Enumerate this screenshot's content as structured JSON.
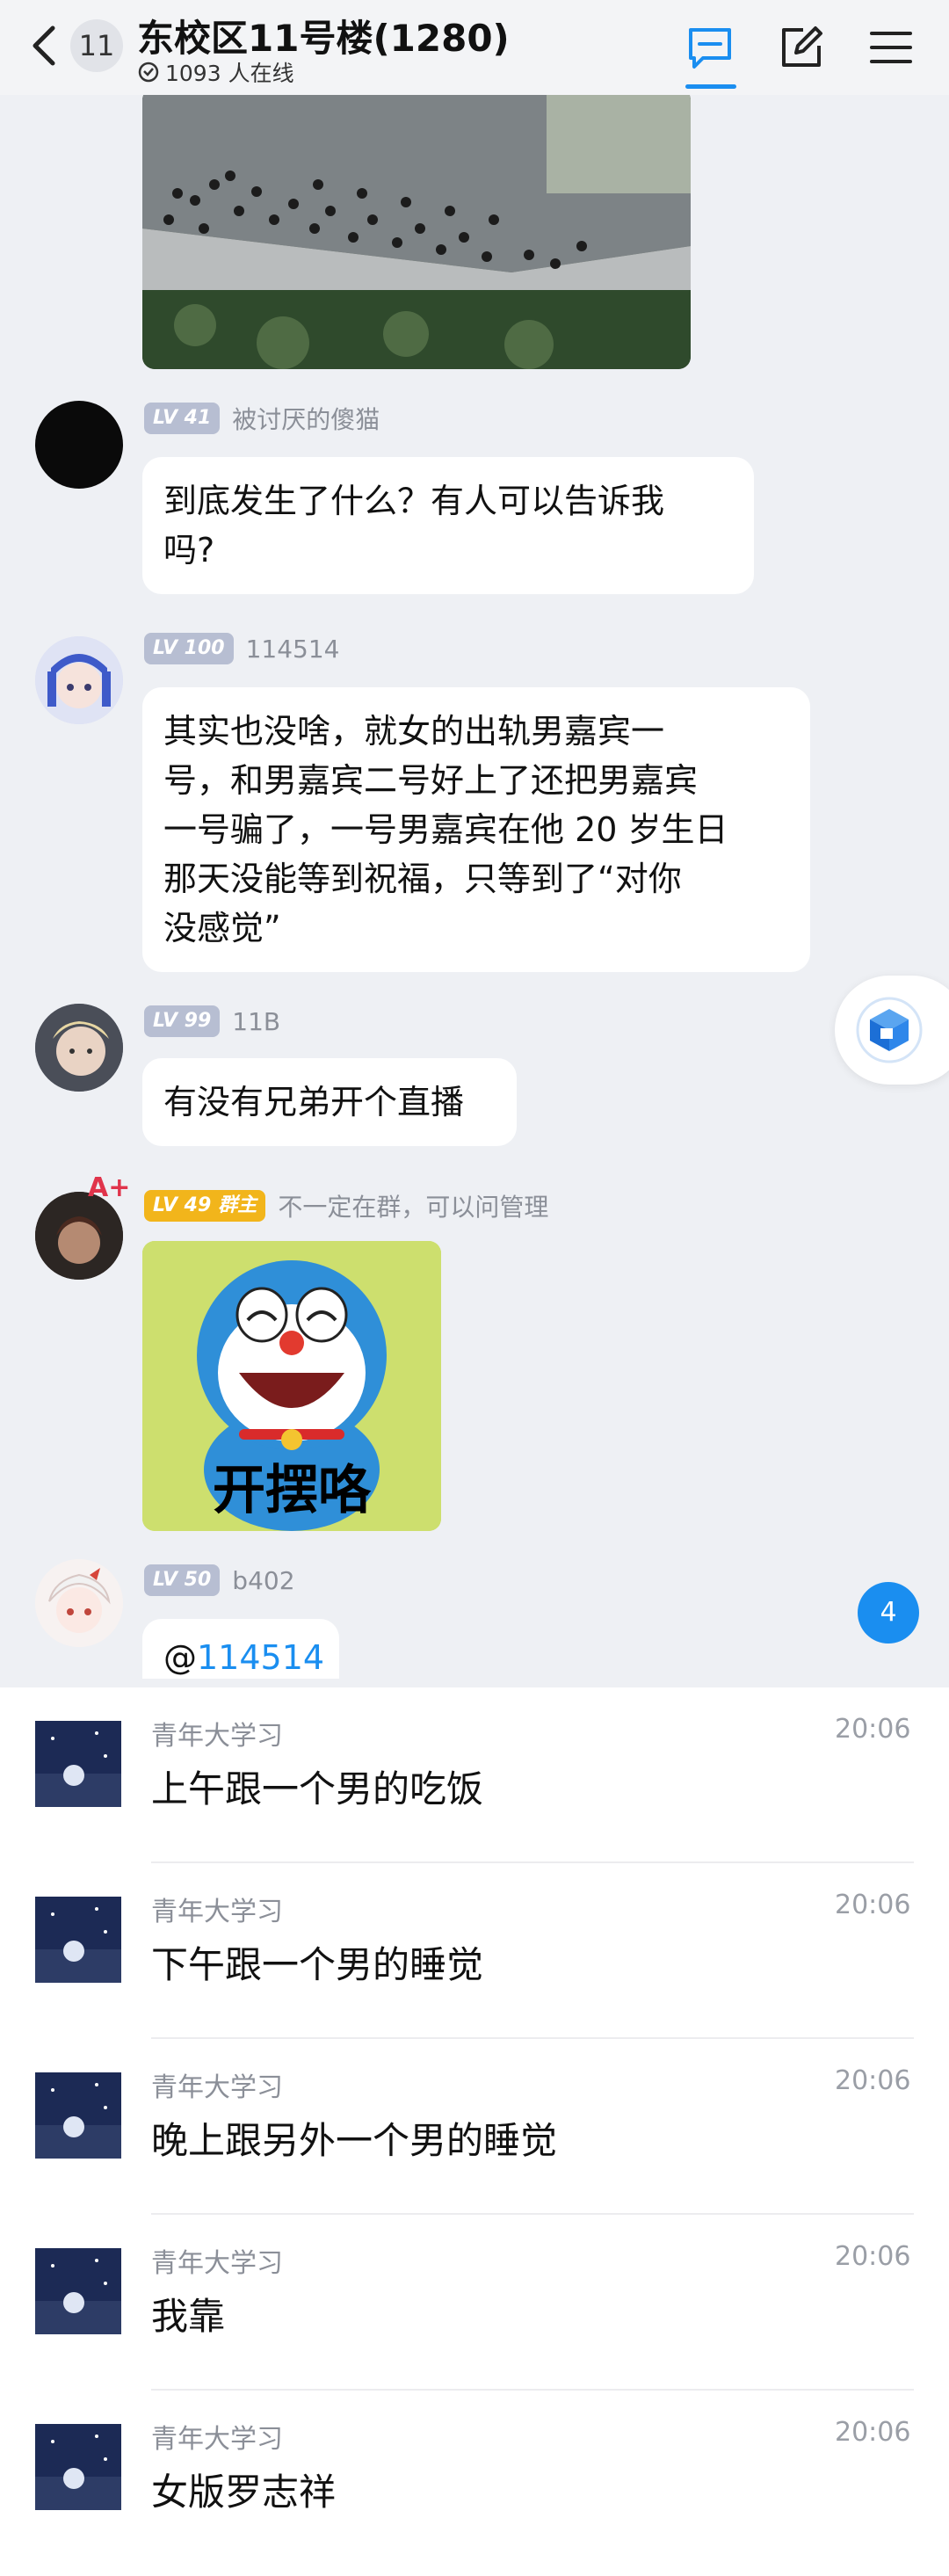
{
  "header": {
    "back_count": "11",
    "title": "东校区11号楼(1280)",
    "online": "1093 人在线"
  },
  "messages": [
    {
      "level": "LV 41",
      "name": "被讨厌的傻猫",
      "text_lines": [
        "到底发生了什么？有人可以告诉我",
        "吗?"
      ]
    },
    {
      "level": "LV 100",
      "name": "114514",
      "text_lines": [
        "其实也没啥，就女的出轨男嘉宾一",
        "号，和男嘉宾二号好上了还把男嘉宾",
        "一号骗了，一号男嘉宾在他 20 岁生日",
        "那天没能等到祝福，只等到了“对你",
        "没感觉”"
      ]
    },
    {
      "level": "LV 99",
      "name": "11B",
      "text_lines": [
        "有没有兄弟开个直播"
      ]
    },
    {
      "level": "LV 49",
      "role": "群主",
      "name": "不一定在群，可以问管理",
      "sticker_caption": "开摆咯",
      "avatar_badge": "A+"
    },
    {
      "level": "LV 50",
      "name": "b402",
      "mention_prefix": "@",
      "mention": "114514"
    }
  ],
  "new_message_count": "4",
  "list_items": [
    {
      "sender": "青年大学习",
      "time": "20:06",
      "text": "上午跟一个男的吃饭"
    },
    {
      "sender": "青年大学习",
      "time": "20:06",
      "text": "下午跟一个男的睡觉"
    },
    {
      "sender": "青年大学习",
      "time": "20:06",
      "text": "晚上跟另外一个男的睡觉"
    },
    {
      "sender": "青年大学习",
      "time": "20:06",
      "text": "我靠"
    },
    {
      "sender": "青年大学习",
      "time": "20:06",
      "text": "女版罗志祥"
    }
  ],
  "colors": {
    "accent": "#1a8ef0",
    "level_badge": "#b7bed2",
    "owner_badge": "#f2b51b",
    "background": "#eef0f4"
  },
  "icons": [
    "back-arrow-icon",
    "chat-icon",
    "edit-icon",
    "menu-icon",
    "online-icon",
    "cube-app-icon"
  ]
}
